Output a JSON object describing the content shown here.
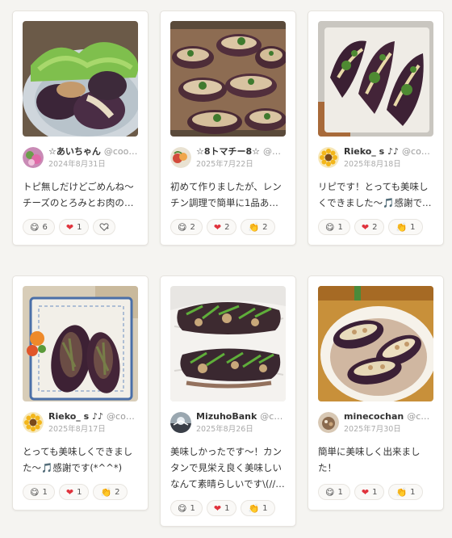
{
  "cards": [
    {
      "author": "☆あいちゃん",
      "handle": "@cook…",
      "date": "2024年8月31日",
      "comment": "トピ無しだけどごめんね〜チーズのとろみとお肉の旨みが茄子に染み込んで美…",
      "reactions": [
        {
          "icon": "😋",
          "count": "6"
        },
        {
          "icon": "❤️",
          "count": "1"
        }
      ],
      "has_add": true
    },
    {
      "author": "☆8トマチー8☆",
      "handle": "@co…",
      "date": "2025年7月22日",
      "comment": "初めて作りましたが、レンチン調理で簡単に1品ありがたいです✨粉チーズを使…",
      "reactions": [
        {
          "icon": "😋",
          "count": "2"
        },
        {
          "icon": "❤️",
          "count": "2"
        },
        {
          "icon": "👏",
          "count": "2"
        }
      ],
      "has_add": false
    },
    {
      "author": "Rieko_ s ♪♪",
      "handle": "@cook…",
      "date": "2025年8月18日",
      "comment": "リピです！とっても美味しくできました〜🎵感謝です(*^^*)",
      "reactions": [
        {
          "icon": "😋",
          "count": "1"
        },
        {
          "icon": "❤️",
          "count": "2"
        },
        {
          "icon": "👏",
          "count": "1"
        }
      ],
      "has_add": false
    },
    {
      "author": "Rieko_ s ♪♪",
      "handle": "@cook…",
      "date": "2025年8月17日",
      "comment": "とっても美味しくできました〜🎵感謝です(*^^*)",
      "reactions": [
        {
          "icon": "😋",
          "count": "1"
        },
        {
          "icon": "❤️",
          "count": "1"
        },
        {
          "icon": "👏",
          "count": "2"
        }
      ],
      "has_add": false
    },
    {
      "author": "MizuhoBank",
      "handle": "@coo…",
      "date": "2025年8月26日",
      "comment": "美味しかったです〜！カンタンで見栄え良く美味しいなんて素晴らしいです\\(//…",
      "reactions": [
        {
          "icon": "😋",
          "count": "1"
        },
        {
          "icon": "❤️",
          "count": "1"
        },
        {
          "icon": "👏",
          "count": "1"
        }
      ],
      "has_add": false
    },
    {
      "author": "minecochan",
      "handle": "@cook…",
      "date": "2025年7月30日",
      "comment": "簡単に美味しく出来ました！",
      "reactions": [
        {
          "icon": "😋",
          "count": "1"
        },
        {
          "icon": "❤️",
          "count": "1"
        },
        {
          "icon": "👏",
          "count": "1"
        }
      ],
      "has_add": false
    }
  ]
}
